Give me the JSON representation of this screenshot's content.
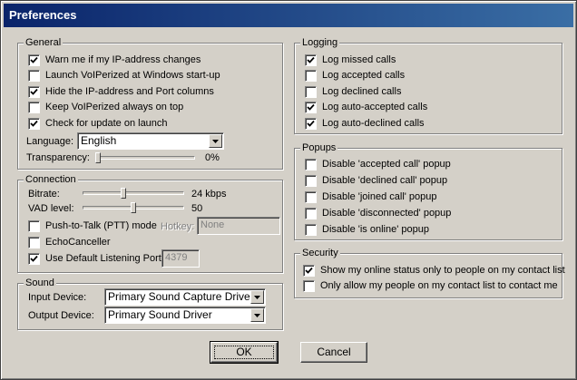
{
  "window": {
    "title": "Preferences"
  },
  "general": {
    "legend": "General",
    "options": [
      {
        "label": "Warn me if my IP-address changes",
        "checked": true
      },
      {
        "label": "Launch VoIPerized at Windows start-up",
        "checked": false
      },
      {
        "label": "Hide the IP-address and Port columns",
        "checked": true
      },
      {
        "label": "Keep VoIPerized always on top",
        "checked": false
      },
      {
        "label": "Check for update on launch",
        "checked": true
      }
    ],
    "language_label": "Language:",
    "language_value": "English",
    "transparency_label": "Transparency:",
    "transparency_value": "0%",
    "transparency_level": 0
  },
  "connection": {
    "legend": "Connection",
    "bitrate_label": "Bitrate:",
    "bitrate_value": "24 kbps",
    "bitrate_level": 0.4,
    "vad_label": "VAD level:",
    "vad_value": "50",
    "vad_level": 0.5,
    "ptt_label": "Push-to-Talk (PTT) mode",
    "ptt_checked": false,
    "hotkey_label": "Hotkey:",
    "hotkey_value": "None",
    "echo_label": "EchoCanceller",
    "echo_checked": false,
    "port_label": "Use Default Listening Port",
    "port_checked": true,
    "port_value": "4379"
  },
  "sound": {
    "legend": "Sound",
    "input_label": "Input Device:",
    "input_value": "Primary Sound Capture Driver",
    "output_label": "Output Device:",
    "output_value": "Primary Sound Driver"
  },
  "logging": {
    "legend": "Logging",
    "options": [
      {
        "label": "Log missed calls",
        "checked": true
      },
      {
        "label": "Log accepted calls",
        "checked": false
      },
      {
        "label": "Log declined calls",
        "checked": false
      },
      {
        "label": "Log auto-accepted calls",
        "checked": true
      },
      {
        "label": "Log auto-declined calls",
        "checked": true
      }
    ]
  },
  "popups": {
    "legend": "Popups",
    "options": [
      {
        "label": "Disable 'accepted call' popup",
        "checked": false
      },
      {
        "label": "Disable 'declined call' popup",
        "checked": false
      },
      {
        "label": "Disable 'joined call' popup",
        "checked": false
      },
      {
        "label": "Disable 'disconnected' popup",
        "checked": false
      },
      {
        "label": "Disable 'is online' popup",
        "checked": false
      }
    ]
  },
  "security": {
    "legend": "Security",
    "options": [
      {
        "label": "Show my online status only to people on my contact list",
        "checked": true
      },
      {
        "label": "Only allow my people on my contact list to contact me",
        "checked": false
      }
    ]
  },
  "buttons": {
    "ok_label": "OK",
    "cancel_label": "Cancel"
  }
}
